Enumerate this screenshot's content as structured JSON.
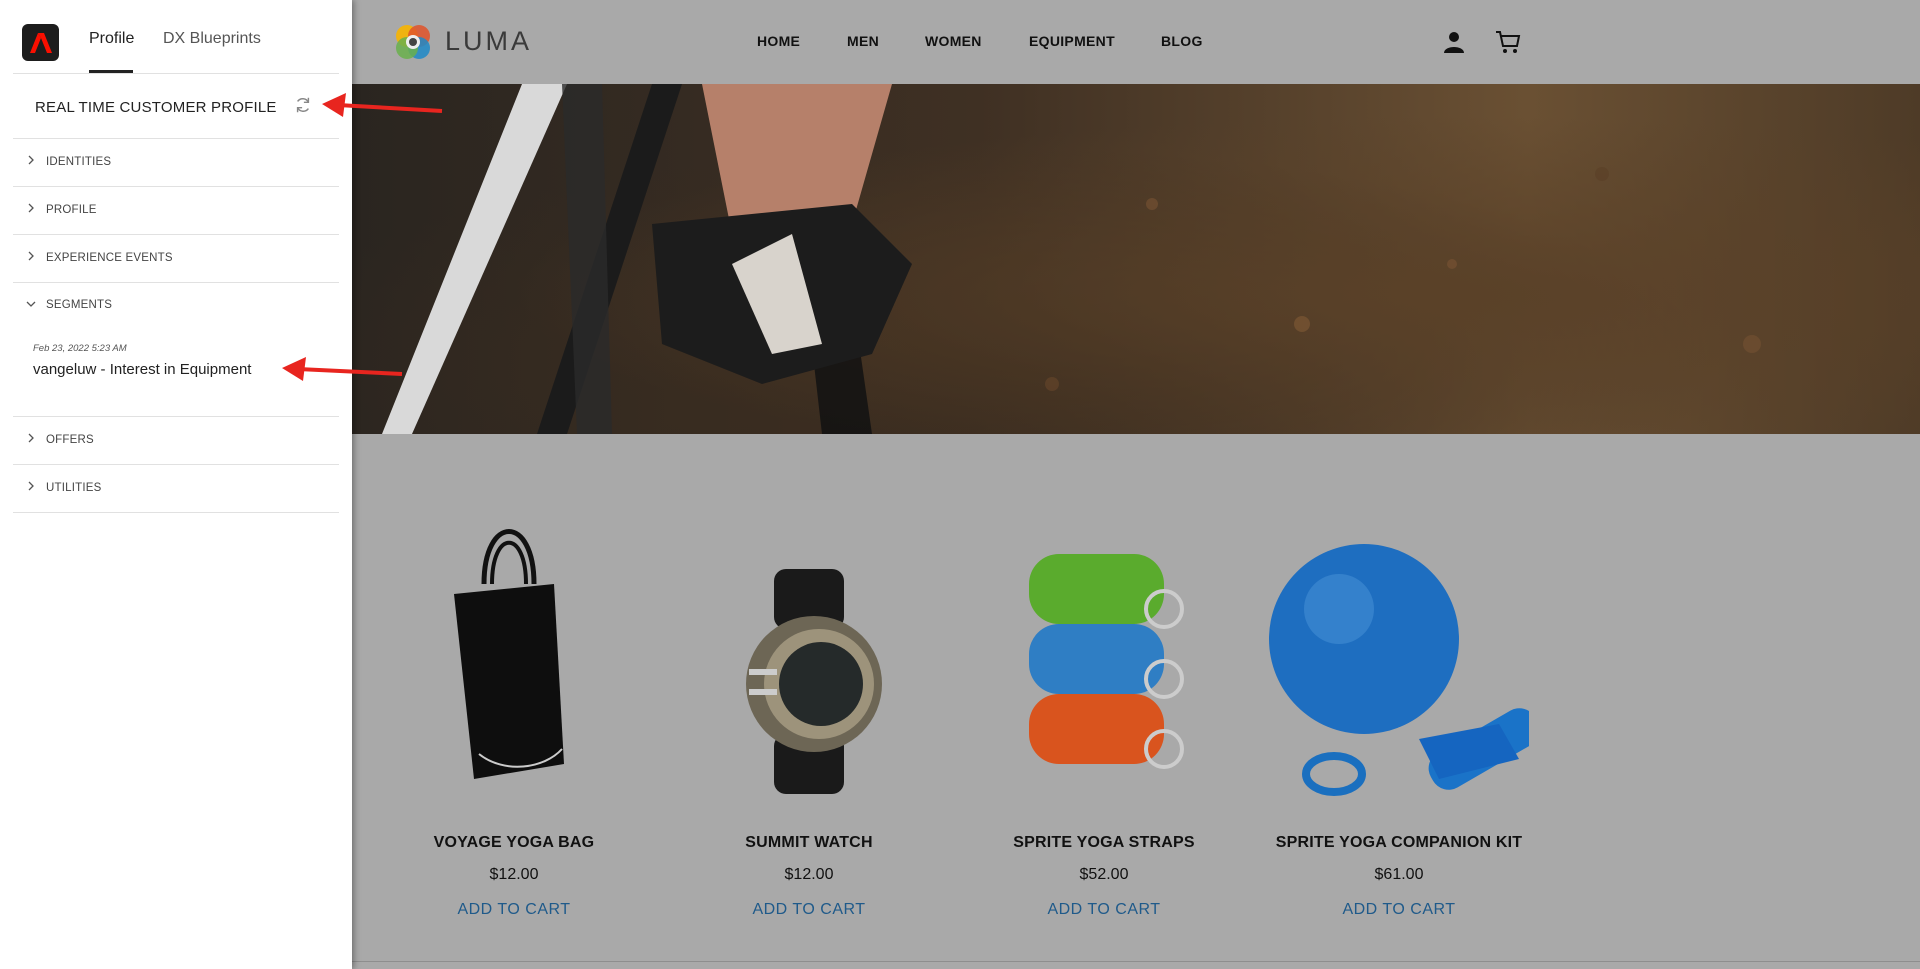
{
  "panel": {
    "tabs": [
      {
        "label": "Profile",
        "active": true
      },
      {
        "label": "DX Blueprints",
        "active": false
      }
    ],
    "rtcp_title": "REAL TIME CUSTOMER PROFILE",
    "sections": {
      "identities": "IDENTITIES",
      "profile": "PROFILE",
      "experience_events": "EXPERIENCE EVENTS",
      "segments": "SEGMENTS",
      "offers": "OFFERS",
      "utilities": "UTILITIES"
    },
    "segment_entry": {
      "date": "Feb 23, 2022 5:23 AM",
      "name": "vangeluw - Interest in Equipment"
    }
  },
  "site": {
    "brand": "LUMA",
    "nav": [
      "HOME",
      "MEN",
      "WOMEN",
      "EQUIPMENT",
      "BLOG"
    ]
  },
  "products": [
    {
      "name": "VOYAGE YOGA BAG",
      "price": "$12.00",
      "cta": "ADD TO CART"
    },
    {
      "name": "SUMMIT WATCH",
      "price": "$12.00",
      "cta": "ADD TO CART"
    },
    {
      "name": "SPRITE YOGA STRAPS",
      "price": "$52.00",
      "cta": "ADD TO CART"
    },
    {
      "name": "SPRITE YOGA COMPANION KIT",
      "price": "$61.00",
      "cta": "ADD TO CART"
    }
  ],
  "colors": {
    "overlay": "#a9a9a9",
    "link": "#1f5a8a",
    "annotation_arrow": "#e8251f",
    "adobe_red": "#fa0f00"
  },
  "icons": [
    "adobe-logo-icon",
    "refresh-icon",
    "chevron-right-icon",
    "chevron-down-icon",
    "luma-logo-icon",
    "user-icon",
    "cart-icon",
    "arrow-annotation"
  ]
}
